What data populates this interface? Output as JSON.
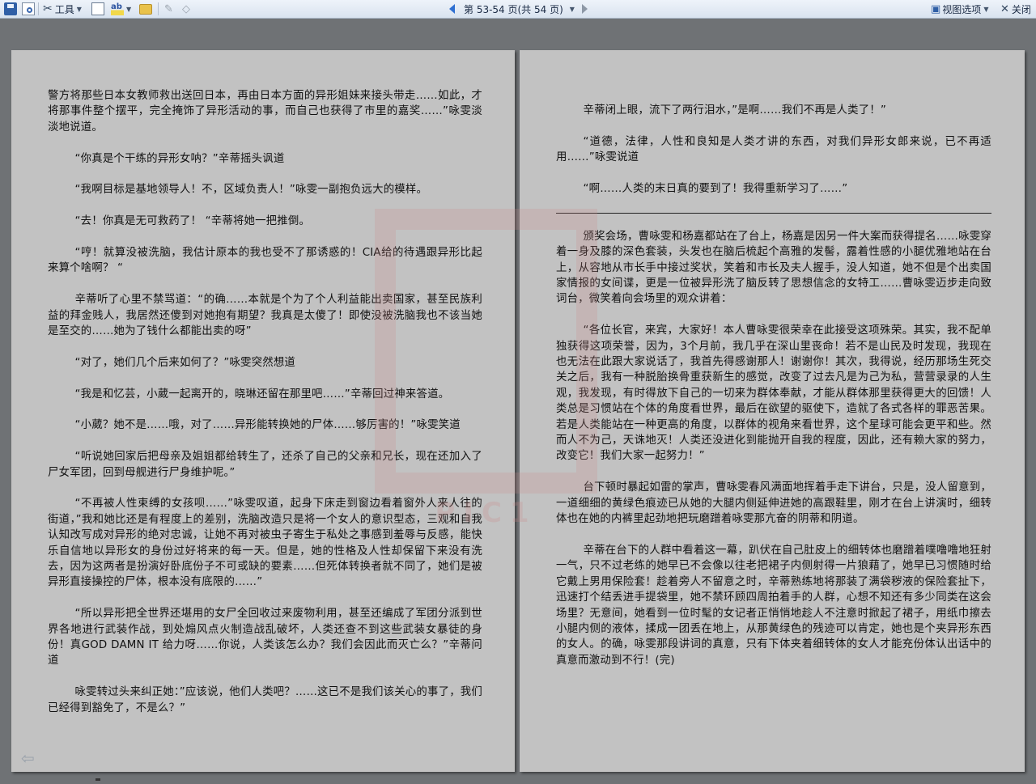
{
  "toolbar": {
    "tools_label": "工具",
    "page_nav_label": "第 53-54 页(共 54 页)",
    "view_options_label": "视图选项",
    "close_label": "关闭"
  },
  "watermark_text": "PIC1",
  "left_page": {
    "paragraphs": [
      {
        "text": "警方将那些日本女教师救出送回日本，再由日本方面的异形姐妹来接头带走……如此，才将那事件整个摆平，完全掩饰了异形活动的事，而自己也获得了市里的嘉奖……”咏雯淡淡地说道。",
        "indent": false
      },
      {
        "text": "“你真是个干练的异形女呐？”辛蒂摇头讽道",
        "indent": true
      },
      {
        "text": "“我啊目标是基地领导人！不，区域负责人！”咏雯一副抱负远大的模样。",
        "indent": true
      },
      {
        "text": "“去！你真是无可救药了！ “辛蒂将她一把推倒。",
        "indent": true
      },
      {
        "text": "“哼！就算没被洗脑，我估计原本的我也受不了那诱惑的！CIA给的待遇跟异形比起来算个啥啊？ “",
        "indent": true
      },
      {
        "text": "辛蒂听了心里不禁骂道：“的确……本就是个为了个人利益能出卖国家，甚至民族利益的拜金贱人，我居然还傻到对她抱有期望？我真是太傻了！即使没被洗脑我也不该当她是至交的……她为了钱什么都能出卖的呀”",
        "indent": true
      },
      {
        "text": "“对了，她们几个后来如何了？”咏雯突然想道",
        "indent": true
      },
      {
        "text": "“我是和忆芸，小葳一起离开的，晓琳还留在那里吧……”辛蒂回过神来答道。",
        "indent": true
      },
      {
        "text": "“小葳？她不是……哦，对了……异形能转换她的尸体……够厉害的！”咏雯笑道",
        "indent": true
      },
      {
        "text": "“听说她回家后把母亲及姐姐都给转生了，还杀了自己的父亲和兄长，现在还加入了尸女军团，回到母舰进行尸身维护呢。”",
        "indent": true
      },
      {
        "text": "“不再被人性束缚的女孩呗……”咏雯叹道，起身下床走到窗边看着窗外人来人往的街道，”我和她比还是有程度上的差别，洗脑改造只是将一个女人的意识型态，三观和自我认知改写成对异形的绝对忠诚，让她不再对被虫子寄生于私处之事感到羞辱与反感，能快乐自信地以异形女的身份过好将来的每一天。但是，她的性格及人性却保留下来没有洗去，因为这两者是扮演好卧底份子不可或缺的要素……但死体转换者就不同了，她们是被异形直接操控的尸体，根本没有底限的……”",
        "indent": true
      },
      {
        "text": "“所以异形把全世界还堪用的女尸全回收过来废物利用，甚至还编成了军团分派到世界各地进行武装作战，到处煽风点火制造战乱破坏，人类还查不到这些武装女暴徒的身份！真GOD DAMN IT 给力呀……你说，人类该怎么办？我们会因此而灭亡么？”辛蒂问道",
        "indent": true
      },
      {
        "text": "咏雯转过头来纠正她：”应该说，他们人类吧？……这已不是我们该关心的事了，我们已经得到豁免了，不是么？”",
        "indent": true
      }
    ]
  },
  "right_page": {
    "paragraphs_top": [
      {
        "text": "辛蒂闭上眼，流下了两行泪水，”是啊……我们不再是人类了！”",
        "indent": true
      },
      {
        "text": "“道德，法律，人性和良知是人类才讲的东西，对我们异形女郎来说，已不再适用……”咏雯说道",
        "indent": true
      },
      {
        "text": "“啊……人类的末日真的要到了！我得重新学习了……”",
        "indent": true
      }
    ],
    "paragraphs_bottom": [
      {
        "text": "颁奖会场，曹咏雯和杨嘉都站在了台上，杨嘉是因另一件大案而获得提名……咏雯穿着一身及膝的深色套装，头发也在脑后梳起个高雅的发髻，露着性感的小腿优雅地站在台上，从容地从市长手中接过奖状，笑着和市长及夫人握手，没人知道，她不但是个出卖国家情报的女间谍，更是一位被异形洗了脑反转了思想信念的女特工……曹咏雯迈步走向致词台，微笑着向会场里的观众讲着：",
        "indent": true
      },
      {
        "text": "“各位长官，来宾，大家好！本人曹咏雯很荣幸在此接受这项殊荣。其实，我不配单独获得这项荣誉，因为，3个月前，我几乎在深山里丧命！若不是山民及时发现，我现在也无法在此跟大家说话了，我首先得感谢那人！谢谢你！其次，我得说，经历那场生死交关之后，我有一种脱胎换骨重获新生的感觉，改变了过去凡是为己为私，营营录录的人生观，我发现，有时得放下自己的一切来为群体奉献，才能从群体那里获得更大的回馈！人类总是习惯站在个体的角度看世界，最后在欲望的驱使下，造就了各式各样的罪恶苦果。若是人类能站在一种更高的角度，以群体的视角来看世界，这个星球可能会更平和些。然而人不为己，天诛地灭！人类还没进化到能抛开自我的程度，因此，还有赖大家的努力，改变它！我们大家一起努力！”",
        "indent": true
      },
      {
        "text": "台下顿时暴起如雷的掌声，曹咏雯春风满面地挥着手走下讲台，只是，没人留意到，一道细细的黄绿色痕迹已从她的大腿内侧延伸进她的高跟鞋里，刚才在台上讲演时，细转体也在她的内裤里起劲地把玩磨蹭着咏雯那亢奋的阴蒂和阴道。",
        "indent": true
      },
      {
        "text": "辛蒂在台下的人群中看着这一幕，趴伏在自己肚皮上的细转体也磨蹭着噗噜噜地狂射一气，只不过老练的她早已不会像以往老把裙子内侧射得一片狼藉了，她早已习惯随时给它戴上男用保险套！趁着旁人不留意之时，辛蒂熟练地将那装了满袋秽液的保险套扯下，迅速打个结丢进手提袋里，她不禁环顾四周拍着手的人群，心想不知还有多少同类在这会场里？无意间，她看到一位时髦的女记者正悄悄地趁人不注意时掀起了裙子，用纸巾擦去小腿内侧的液体，揉成一团丢在地上，从那黄绿色的残迹可以肯定，她也是个夹异形东西的女人。的确，咏雯那段讲词的真意，只有下体夹着细转体的女人才能充份体认出话中的真意而激动到不行！(完)",
        "indent": true
      }
    ]
  }
}
